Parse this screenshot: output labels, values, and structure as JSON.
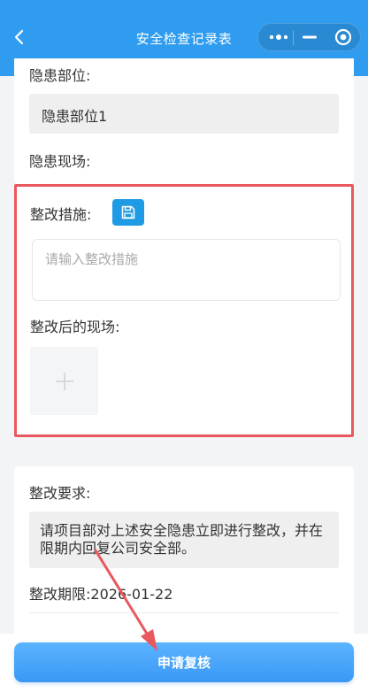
{
  "navbar": {
    "title": "安全检查记录表",
    "back_icon": "chevron-left-icon",
    "more_icon": "more-dots-icon",
    "minimize_icon": "minimize-icon",
    "close_icon": "target-close-icon",
    "background_color": "#2f9cf0"
  },
  "hazard": {
    "location_label": "隐患部位:",
    "location_value": "隐患部位1",
    "scene_label": "隐患现场:"
  },
  "rectification": {
    "measures_label": "整改措施:",
    "save_icon": "save-icon",
    "measures_placeholder": "请输入整改措施",
    "after_scene_label": "整改后的现场:",
    "upload_icon": "plus-icon",
    "highlight_color": "#e8585e"
  },
  "requirements": {
    "label": "整改要求:",
    "text": "请项目部对上述安全隐患立即进行整改，并在限期内回复公司安全部。",
    "deadline_label": "整改期限:",
    "deadline_value": "2026-01-22"
  },
  "footer": {
    "submit_label": "申请复核",
    "button_color": "#3a98f5"
  },
  "annotation": {
    "arrow_color": "#e8585e"
  }
}
